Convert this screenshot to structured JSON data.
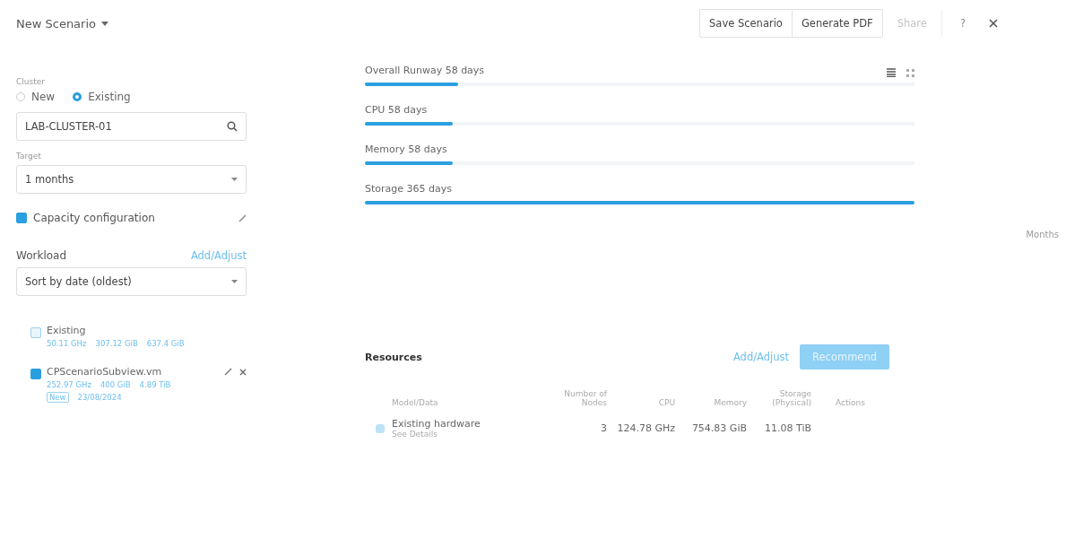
{
  "header": {
    "title": "New Scenario",
    "buttons": [
      {
        "label": "Save Scenario",
        "disabled": false
      },
      {
        "label": "Generate PDF",
        "disabled": false
      },
      {
        "label": "Share",
        "disabled": true
      }
    ],
    "help": "?"
  },
  "cluster": {
    "label": "Cluster",
    "options": [
      {
        "label": "New",
        "selected": false
      },
      {
        "label": "Existing",
        "selected": true
      }
    ],
    "value": "LAB-CLUSTER-01"
  },
  "target": {
    "label": "Target",
    "value": "1 months"
  },
  "capacity": {
    "label": "Capacity configuration",
    "checked": true
  },
  "workload": {
    "label": "Workload",
    "action": "Add/Adjust",
    "sort": "Sort by date (oldest)",
    "items": [
      {
        "name": "Existing",
        "checked": false,
        "stats": [
          "50.11 GHz",
          "307.12 GiB",
          "637.4 GiB"
        ],
        "editable": false
      },
      {
        "name": "CPScenarioSubview.vm",
        "checked": true,
        "stats": [
          "252.97 GHz",
          "400 GiB",
          "4.89 TiB"
        ],
        "tag": "New",
        "date": "23/08/2024",
        "editable": true
      }
    ]
  },
  "runway": {
    "bars": [
      {
        "label": "Overall Runway 58 days",
        "level": 0.17
      },
      {
        "label": "CPU 58 days",
        "level": 0.16
      },
      {
        "label": "Memory 58 days",
        "level": 0.16
      },
      {
        "label": "Storage 365 days",
        "level": 1.0
      }
    ],
    "axis_label": "Months"
  },
  "resources": {
    "title": "Resources",
    "action": "Add/Adjust",
    "recommend": {
      "label": "Recommend",
      "disabled": true
    },
    "columns": [
      "Model/Data",
      "Number of Nodes",
      "CPU",
      "Memory",
      "Storage (Physical)",
      "Actions"
    ],
    "rows": [
      {
        "checked": true,
        "details": "See Details",
        "cells": [
          "Existing hardware",
          "3",
          "124.78 GHz",
          "754.83 GiB",
          "11.08 TiB"
        ]
      }
    ]
  }
}
